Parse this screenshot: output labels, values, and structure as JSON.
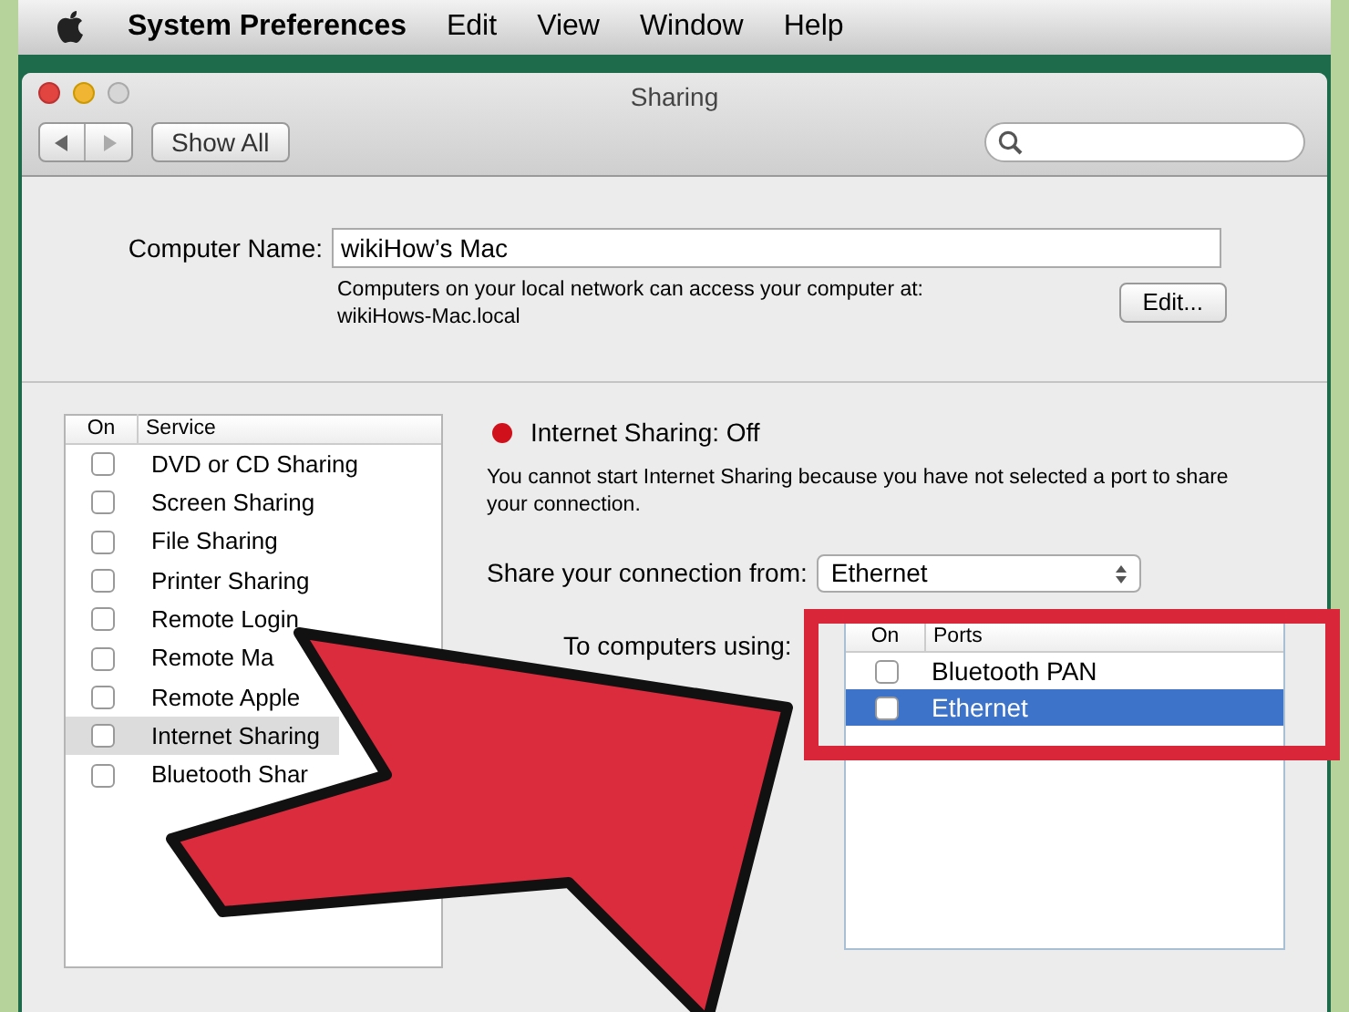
{
  "menu_bar": {
    "items": [
      {
        "label": "System Preferences",
        "bold": true
      },
      {
        "label": "Edit",
        "bold": false
      },
      {
        "label": "View",
        "bold": false
      },
      {
        "label": "Window",
        "bold": false
      },
      {
        "label": "Help",
        "bold": false
      }
    ]
  },
  "window": {
    "title": "Sharing"
  },
  "toolbar": {
    "show_all": "Show All"
  },
  "computer_name": {
    "label": "Computer Name:",
    "value": "wikiHow’s Mac",
    "note": "Computers on your local network can access your computer at:",
    "address": "wikiHows-Mac.local",
    "edit_button": "Edit..."
  },
  "services": {
    "columns": [
      "On",
      "Service"
    ],
    "rows": [
      {
        "name": "DVD or CD Sharing",
        "checked": false,
        "selected": false
      },
      {
        "name": "Screen Sharing",
        "checked": false,
        "selected": false
      },
      {
        "name": "File Sharing",
        "checked": false,
        "selected": false
      },
      {
        "name": "Printer Sharing",
        "checked": false,
        "selected": false
      },
      {
        "name": "Remote Login",
        "checked": false,
        "selected": false
      },
      {
        "name": "Remote Ma",
        "checked": false,
        "selected": false
      },
      {
        "name": "Remote Apple",
        "checked": false,
        "selected": false
      },
      {
        "name": "Internet Sharing",
        "checked": false,
        "selected": true
      },
      {
        "name": "Bluetooth Shar",
        "checked": false,
        "selected": false
      }
    ]
  },
  "status": {
    "on": false,
    "label": "Internet Sharing: Off",
    "description": "You cannot start Internet Sharing because you have not selected a port to share your connection."
  },
  "share_from": {
    "label": "Share your connection from:",
    "value": "Ethernet"
  },
  "to_computers": {
    "label": "To computers using:",
    "columns": [
      "On",
      "Ports"
    ],
    "rows": [
      {
        "name": "Bluetooth PAN",
        "checked": false,
        "selected": false
      },
      {
        "name": "Ethernet",
        "checked": false,
        "selected": true
      }
    ]
  }
}
